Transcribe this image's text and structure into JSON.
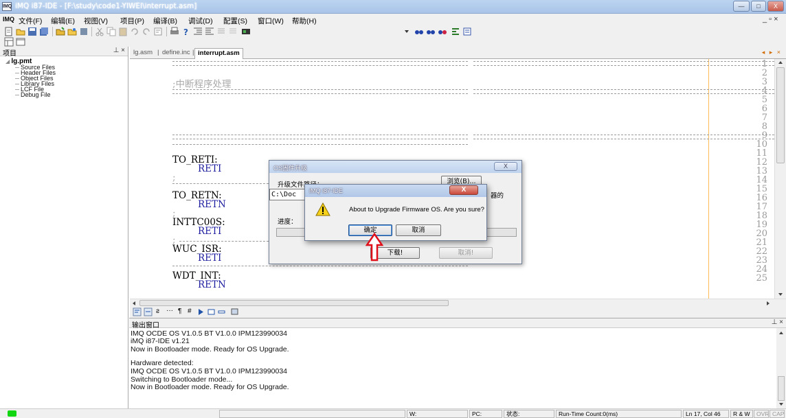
{
  "window": {
    "app_icon": "IMQ",
    "title": "iMQ i87-IDE - [F:\\study\\code1-YIWEI\\interrupt.asm]",
    "controls": {
      "minimize": "—",
      "maximize": "□",
      "close": "X"
    }
  },
  "menubar": {
    "doc_icon": "IMQ",
    "items": [
      "文件(F)",
      "编辑(E)",
      "视图(V)",
      "项目(P)",
      "编译(B)",
      "调试(D)",
      "配置(S)",
      "窗口(W)",
      "帮助(H)"
    ],
    "mdi_controls": "_ ▫ ×"
  },
  "project_panel": {
    "title": "项目",
    "controls": "⊥ ×",
    "root": "lg.pmt",
    "nodes": [
      "Source Files",
      "Header Files",
      "Object Files",
      "Library Files",
      "LCF File",
      "Debug File"
    ]
  },
  "editor": {
    "tabs": [
      "lg.asm",
      "define.inc",
      "interrupt.asm"
    ],
    "active_tab": "interrupt.asm",
    "tab_nav": "◂ ▸ ×",
    "lines": [
      {
        "n": "1",
        "text": ""
      },
      {
        "n": "2",
        "text": ""
      },
      {
        "n": "3",
        "text": ";中断程序处理"
      },
      {
        "n": "4",
        "text": ""
      },
      {
        "n": "5",
        "text": ""
      },
      {
        "n": "6",
        "text": ""
      },
      {
        "n": "7",
        "text": ""
      },
      {
        "n": "8",
        "text": ""
      },
      {
        "n": "9",
        "text": ""
      },
      {
        "n": "10",
        "text": ""
      },
      {
        "n": "11",
        "text": "TO_RETI:"
      },
      {
        "n": "12",
        "text": "RETI"
      },
      {
        "n": "13",
        "text": ";"
      },
      {
        "n": "14",
        "text": ""
      },
      {
        "n": "15",
        "text": "TO_RETN:"
      },
      {
        "n": "16",
        "text": "RETN"
      },
      {
        "n": "17",
        "text": ";"
      },
      {
        "n": "18",
        "text": "INTTC00S:"
      },
      {
        "n": "19",
        "text": "RETI"
      },
      {
        "n": "20",
        "text": ";"
      },
      {
        "n": "21",
        "text": "WUC_ISR:"
      },
      {
        "n": "22",
        "text": "RETI"
      },
      {
        "n": "23",
        "text": ""
      },
      {
        "n": "24",
        "text": "WDT_INT:"
      },
      {
        "n": "25",
        "text": "RETN"
      }
    ]
  },
  "output_panel": {
    "title": "输出窗口",
    "controls": "⊥ ×",
    "lines": [
      "IMQ OCDE  OS V1.0.5  BT V1.0.0  IPM123990034",
      "iMQ i87-IDE v1.21",
      "Now in Bootloader mode. Ready for OS Upgrade.",
      "",
      "Hardware detected:",
      "IMQ OCDE  OS V1.0.5  BT V1.0.0  IPM123990034",
      "Switching to Bootloader mode...",
      "Now in Bootloader mode. Ready for OS Upgrade."
    ]
  },
  "statusbar": {
    "w": "W:",
    "pc": "PC:",
    "state": "状态:",
    "runtime": "Run-Time Count:0(ms)",
    "position": "Ln 17, Col 46",
    "mode": "R & W",
    "ovr": "OVR",
    "cap": "CAP",
    "led_color": "#13d613"
  },
  "os_dialog": {
    "title": "OS固件升级",
    "close": "X",
    "path_label": "升级文件路径：",
    "browse": "浏览(B)...",
    "path_value": "C:\\Doc",
    "side_text": "器的",
    "progress_label": "进度：",
    "progress": 0,
    "download": "下载!",
    "cancel": "取消!"
  },
  "confirm_dialog": {
    "title": "iMQ i87-IDE",
    "close": "X",
    "icon": "warning-icon",
    "message": "About to Upgrade Firmware OS. Are you sure?",
    "ok": "确定",
    "cancel": "取消"
  },
  "colors": {
    "keyword": "#1e1ea0",
    "margin_line": "#ffbb55",
    "annotation_arrow": "#e0101a"
  }
}
